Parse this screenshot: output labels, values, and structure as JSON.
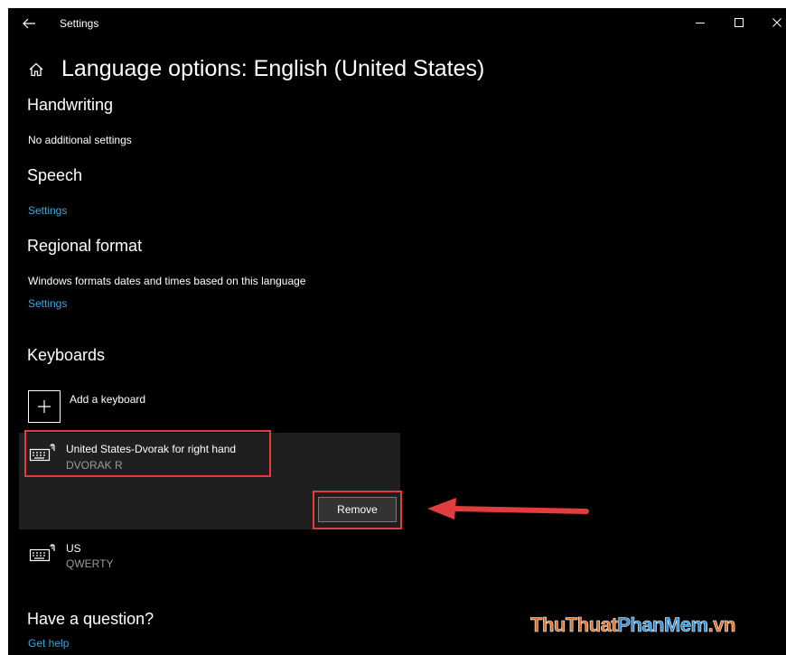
{
  "window": {
    "title": "Settings"
  },
  "page": {
    "title": "Language options: English (United States)"
  },
  "handwriting": {
    "heading": "Handwriting",
    "text": "No additional settings"
  },
  "speech": {
    "heading": "Speech",
    "link": "Settings"
  },
  "regional": {
    "heading": "Regional format",
    "text": "Windows formats dates and times based on this language",
    "link": "Settings"
  },
  "keyboards": {
    "heading": "Keyboards",
    "add_label": "Add a keyboard",
    "items": [
      {
        "name": "United States-Dvorak for right hand",
        "sub": "DVORAK R",
        "selected": true
      },
      {
        "name": "US",
        "sub": "QWERTY",
        "selected": false
      }
    ],
    "remove_label": "Remove"
  },
  "help": {
    "heading": "Have a question?",
    "link": "Get help"
  },
  "watermark": {
    "part1": "ThuThuat",
    "part2": "PhanMem",
    "part3": ".vn"
  },
  "colors": {
    "background": "#000000",
    "link": "#3fa7dd",
    "selected_panel": "#1f1f1f",
    "highlight": "#e23c3c"
  }
}
